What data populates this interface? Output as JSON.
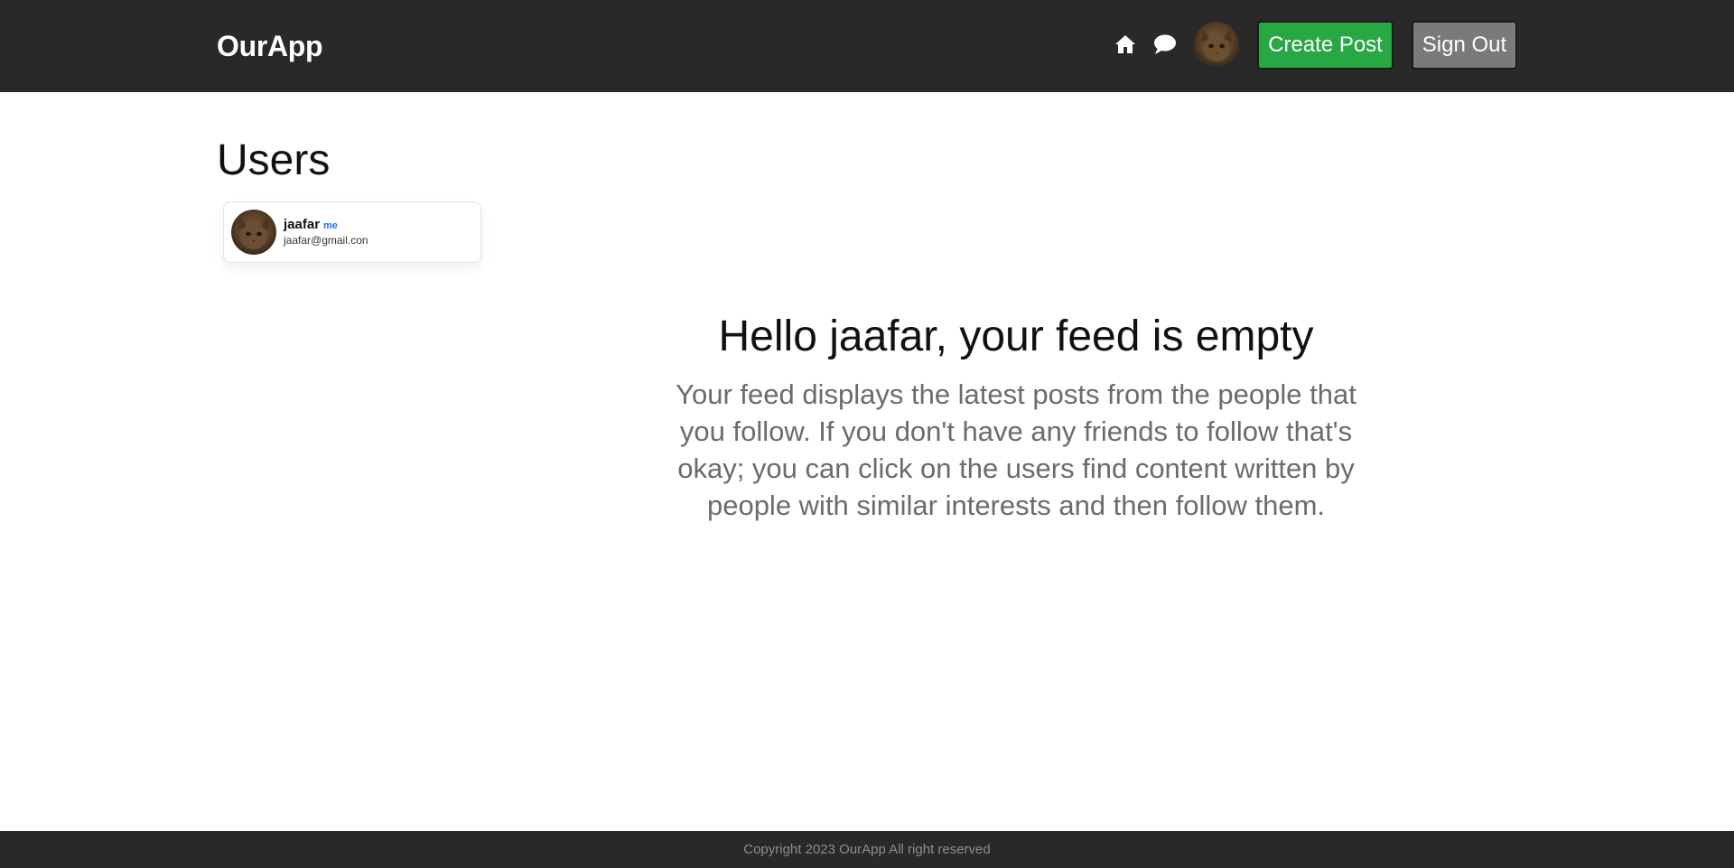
{
  "header": {
    "brand": "OurApp",
    "icons": [
      "home-icon",
      "chat-icon"
    ],
    "create_post_label": "Create Post",
    "sign_out_label": "Sign Out"
  },
  "users": {
    "title": "Users",
    "items": [
      {
        "name": "jaafar",
        "badge": "me",
        "email": "jaafar@gmail.con"
      }
    ]
  },
  "feed": {
    "heading": "Hello jaafar, your feed is empty",
    "description": "Your feed displays the latest posts from the people that you follow. If you don't have any friends to follow that's okay; you can click on the users find content written by people with similar interests and then follow them."
  },
  "footer": {
    "text": "Copyright 2023 OurApp All right reserved"
  },
  "colors": {
    "header_bg": "#292929",
    "create_button": "#28a745",
    "sign_out_button": "#7a7a7a",
    "me_badge": "#1a73e8"
  }
}
